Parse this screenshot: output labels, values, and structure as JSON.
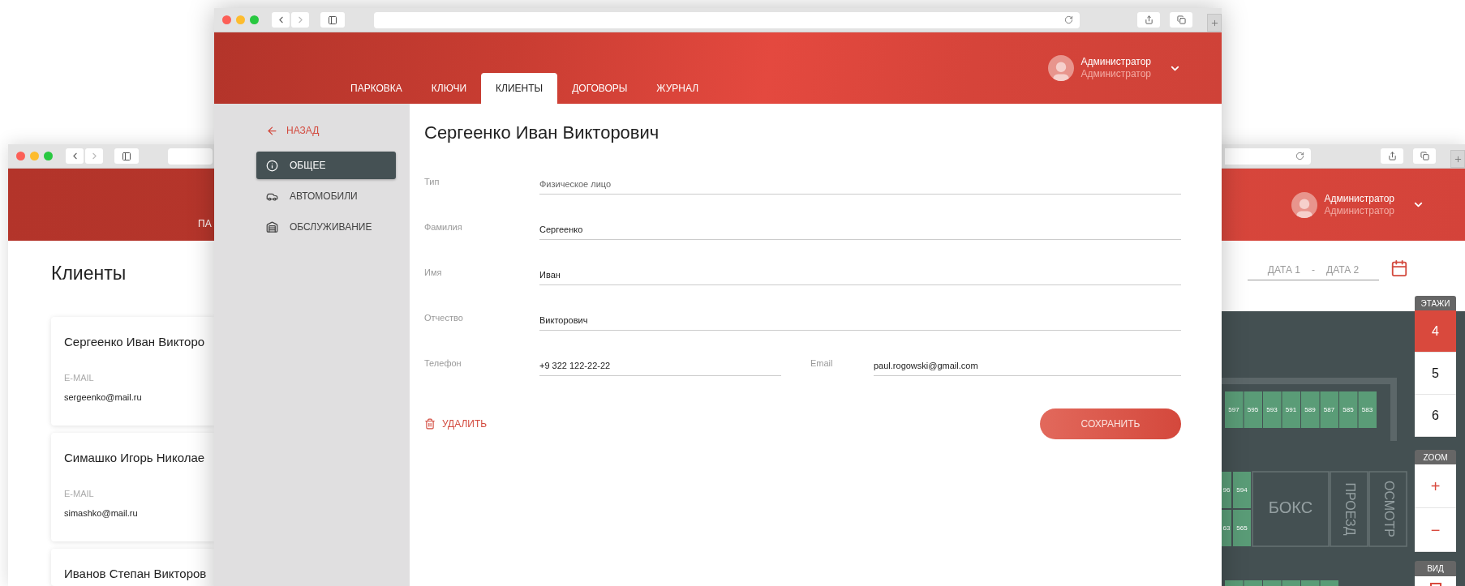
{
  "back_window": {
    "nav_tab": "ПА",
    "user": {
      "name": "Администратор",
      "role": "Администратор"
    },
    "page_title": "Клиенты",
    "clients": [
      {
        "name": "Сергеенко Иван Викторо",
        "email_label": "E-MAIL",
        "email": "sergeenko@mail.ru"
      },
      {
        "name": "Симашко Игорь Николае",
        "email_label": "E-MAIL",
        "email": "simashko@mail.ru"
      },
      {
        "name": "Иванов Степан Викторов"
      }
    ],
    "date_range": {
      "from": "ДАТА 1",
      "separator": "-",
      "to": "ДАТА 2"
    },
    "map": {
      "top_spots": [
        "597",
        "595",
        "593",
        "591",
        "589",
        "587",
        "585",
        "583"
      ],
      "middle_spots": [
        "96",
        "594",
        "63",
        "565"
      ],
      "areas": [
        {
          "label": "БОКС",
          "kind": "horizontal"
        },
        {
          "label": "ПРОЕЗД",
          "kind": "vertical"
        },
        {
          "label": "ОСМОТР",
          "kind": "vertical"
        }
      ]
    },
    "floors": {
      "title": "ЭТАЖИ",
      "items": [
        {
          "label": "4",
          "selected": true
        },
        {
          "label": "5",
          "selected": false
        },
        {
          "label": "6",
          "selected": false
        }
      ]
    },
    "zoom": {
      "title": "ZOOM",
      "controls": [
        "+",
        "−"
      ]
    },
    "view": {
      "title": "ВИД"
    }
  },
  "front_window": {
    "tabs": [
      {
        "label": "ПАРКОВКА",
        "selected": false
      },
      {
        "label": "КЛЮЧИ",
        "selected": false
      },
      {
        "label": "КЛИЕНТЫ",
        "selected": true
      },
      {
        "label": "ДОГОВОРЫ",
        "selected": false
      },
      {
        "label": "ЖУРНАЛ",
        "selected": false
      }
    ],
    "user": {
      "name": "Администратор",
      "role": "Администратор"
    },
    "back_link": "НАЗАД",
    "side_menu": [
      {
        "label": "ОБЩЕЕ",
        "kind": "info",
        "selected": true
      },
      {
        "label": "АВТОМОБИЛИ",
        "kind": "car",
        "selected": false
      },
      {
        "label": "ОБСЛУЖИВАНИЕ",
        "kind": "garage",
        "selected": false
      }
    ],
    "title": "Сергеенко Иван Викторович",
    "fields": [
      {
        "label": "Тип",
        "value": "Физическое лицо",
        "kind": "select"
      },
      {
        "label": "Фамилия",
        "value": "Сергеенко",
        "kind": "text"
      },
      {
        "label": "Имя",
        "value": "Иван",
        "kind": "text"
      },
      {
        "label": "Отчество",
        "value": "Викторович",
        "kind": "text"
      }
    ],
    "phone": {
      "label": "Телефон",
      "value": "+9 322 122-22-22"
    },
    "email": {
      "label": "Email",
      "value": "paul.rogowski@gmail.com"
    },
    "delete_button": "УДАЛИТЬ",
    "save_button": "СОХРАНИТЬ"
  }
}
